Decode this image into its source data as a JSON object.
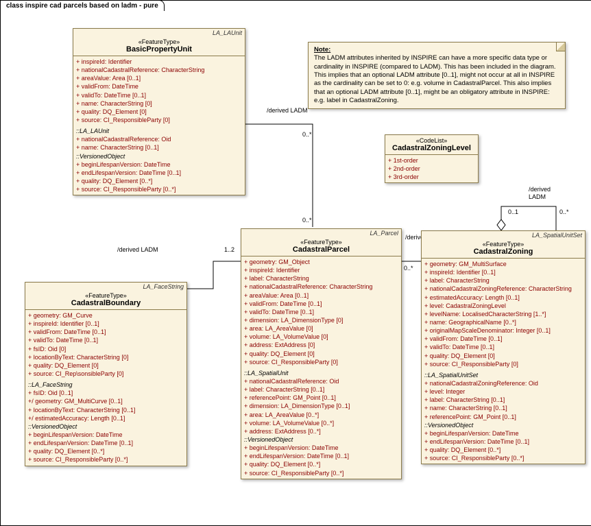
{
  "diagram": {
    "title": "class inspire cad parcels based on ladm - pure"
  },
  "note": {
    "heading": "Note:",
    "body": "The LADM attributes inherited by INSPIRE can have a more specific data type or cardinality in INSPIRE (compared to LADM). This has been included in the diagram. This implies that an optional LADM attribute [0..1], might not occur at all in INSPIRE as the cardinality can be set to 0: e.g. volume in CadastralParcel. This also implies that an optional LADM attribute [0..1], might be an obligatory attribute in INSPIRE: e.g. label in CadastralZoning."
  },
  "labels": {
    "derivedLADM": "/derived LADM",
    "derived": "/derived",
    "ladm": "LADM",
    "m0s": "0..*",
    "m01": "0..1",
    "m12": "1..2"
  },
  "classes": {
    "bpu": {
      "context": "LA_LAUnit",
      "stereo": "«FeatureType»",
      "name": "BasicPropertyUnit",
      "attrs": [
        "+   inspireId:  Identifier",
        "+   nationalCadastralReference:  CharacterString",
        "+   areaValue:  Area [0..1]",
        "+   validFrom:  DateTime",
        "+   validTo:  DateTime [0..1]",
        "+   name:  CharacterString [0]",
        "+   quality:  DQ_Element [0]",
        "+   source:  CI_ResponsibleParty [0]"
      ],
      "sub1": "::LA_LAUnit",
      "attrs2": [
        "+   nationalCadastralReference:  Oid",
        "+   name:  CharacterString [0..1]"
      ],
      "sub2": "::VersionedObject",
      "attrs3": [
        "+   beginLifespanVersion:  DateTime",
        "+   endLifespanVersion:  DateTime [0..1]",
        "+   quality:  DQ_Element [0..*]",
        "+   source:  CI_ResponsibleParty [0..*]"
      ]
    },
    "czl": {
      "stereo": "«CodeList»",
      "name": "CadastralZoningLevel",
      "attrs": [
        "+   1st-order",
        "+   2nd-order",
        "+   3rd-order"
      ]
    },
    "cp": {
      "context": "LA_Parcel",
      "stereo": "«FeatureType»",
      "name": "CadastralParcel",
      "attrs": [
        "+   geometry:  GM_Object",
        "+   inspireId:  Identifier",
        "+   label:  CharacterString",
        "+   nationalCadastralReference:  CharacterString",
        "+   areaValue:  Area [0..1]",
        "+   validFrom:  DateTime [0..1]",
        "+   validTo:  DateTime [0..1]",
        "+   dimension:  LA_DimensionType [0]",
        "+   area:  LA_AreaValue [0]",
        "+   volume:  LA_VolumeValue [0]",
        "+   address:  ExtAddress [0]",
        "+   quality:  DQ_Element [0]",
        "+   source:  CI_ResponsibleParty [0]"
      ],
      "sub1": "::LA_SpatialUnit",
      "attrs2": [
        "+   nationalCadastralReference:  Oid",
        "+   label:  CharacterString [0..1]",
        "+   referencePoint:  GM_Point [0..1]",
        "+   dimension:  LA_DimensionType [0..1]",
        "+   area:  LA_AreaValue [0..*]",
        "+   volume:  LA_VolumeValue [0..*]",
        "+   address:  ExtAddress [0..*]"
      ],
      "sub2": "::VersionedObject",
      "attrs3": [
        "+   beginLifespanVersion:  DateTime",
        "+   endLifespanVersion:  DateTime [0..1]",
        "+   quality:  DQ_Element [0..*]",
        "+   source:  CI_ResponsibleParty [0..*]"
      ]
    },
    "cb": {
      "context": "LA_FaceString",
      "stereo": "«FeatureType»",
      "name": "CadastralBoundary",
      "attrs": [
        "+   geometry:  GM_Curve",
        "+   inspireId:  Identifier [0..1]",
        "+   validFrom:  DateTime [0..1]",
        "+   validTo:  DateTime [0..1]",
        "+   fsID:  Oid [0]",
        "+   locationByText:  CharacterString [0]",
        "+   quality:  DQ_Element [0]",
        "+   source:  CI_Rep\\sonsibleParty [0]"
      ],
      "sub1": "::LA_FaceString",
      "attrs2": [
        "+   fsID:  Oid [0..1]",
        "+/  geometry:  GM_MultiCurve [0..1]",
        "+   locationByText:  CharacterString [0..1]",
        "+/  estimatedAccuracy:  Length [0..1]"
      ],
      "sub2": "::VersionedObject",
      "attrs3": [
        "+   beginLifespanVersion:  DateTime",
        "+   endLifespanVersion:  DateTime [0..1]",
        "+   quality:  DQ_Element [0..*]",
        "+   source:  CI_ResponsibleParty [0..*]"
      ]
    },
    "cz": {
      "context": "LA_SpatialUnitSet",
      "stereo": "«FeatureType»",
      "name": "CadastralZoning",
      "attrs": [
        "+   geometry:  GM_MultiSurface",
        "+   inspireId:  Identifier [0..1]",
        "+   label:  CharacterString",
        "+   nationalCadastralZoningReference:  CharacterString",
        "+   estimatedAccuracy:  Length [0..1]",
        "+   level:  CadastralZoningLevel",
        "+   levelName:  LocalisedCharacterString [1..*]",
        "+   name:  GeographicalName [0..*]",
        "+   originalMapScaleDenominator:  Integer [0..1]",
        "+   validFrom:  DateTime [0..1]",
        "+   validTo:  DateTime [0..1]",
        "+   quality:  DQ_Element [0]",
        "+   source:  CI_ResponsibleParty [0]"
      ],
      "sub1": "::LA_SpatialUnitSet",
      "attrs2": [
        "+   nationalCadastralZoningReference:  Oid",
        "+   level:  Integer",
        "+   label:  CharacterString [0..1]",
        "+   name:  CharacterString [0..1]",
        "+   referencePoint:  GM_Point [0..1]"
      ],
      "sub2": "::VersionedObject",
      "attrs3": [
        "+   beginLifespanVersion:  DateTime",
        "+   endLifespanVersion:  DateTime [0..1]",
        "+   quality:  DQ_Element [0..*]",
        "+   source:  CI_ResponsibleParty [0..*]"
      ]
    }
  }
}
